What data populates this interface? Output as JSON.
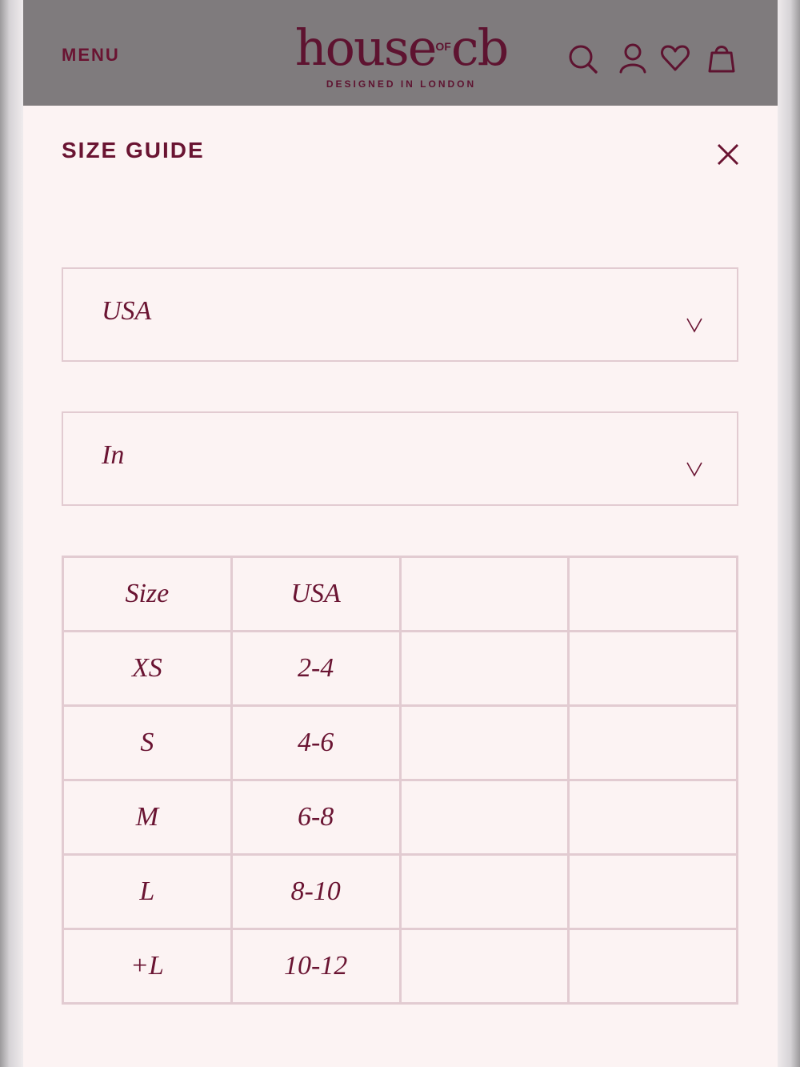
{
  "header": {
    "menu_label": "MENU",
    "logo": {
      "word_left": "house",
      "word_small": "OF",
      "word_right": "cb",
      "tagline": "DESIGNED IN LONDON"
    },
    "icons": [
      "search-icon",
      "account-icon",
      "wishlist-heart-icon",
      "shopping-bag-icon"
    ]
  },
  "size_guide": {
    "title": "SIZE GUIDE",
    "close_icon": "close-icon",
    "region_select": {
      "value": "USA"
    },
    "unit_select": {
      "value": "In"
    },
    "table": {
      "header": [
        "Size",
        "USA",
        "",
        ""
      ],
      "rows": [
        [
          "XS",
          "2-4",
          "",
          ""
        ],
        [
          "S",
          "4-6",
          "",
          ""
        ],
        [
          "M",
          "6-8",
          "",
          ""
        ],
        [
          "L",
          "8-10",
          "",
          ""
        ],
        [
          "+L",
          "10-12",
          "",
          ""
        ]
      ]
    }
  },
  "colors": {
    "brand": "#6a1432",
    "header_bg": "#7f7b7d",
    "panel_bg": "#fcf3f3",
    "border": "#e2cbd1"
  }
}
